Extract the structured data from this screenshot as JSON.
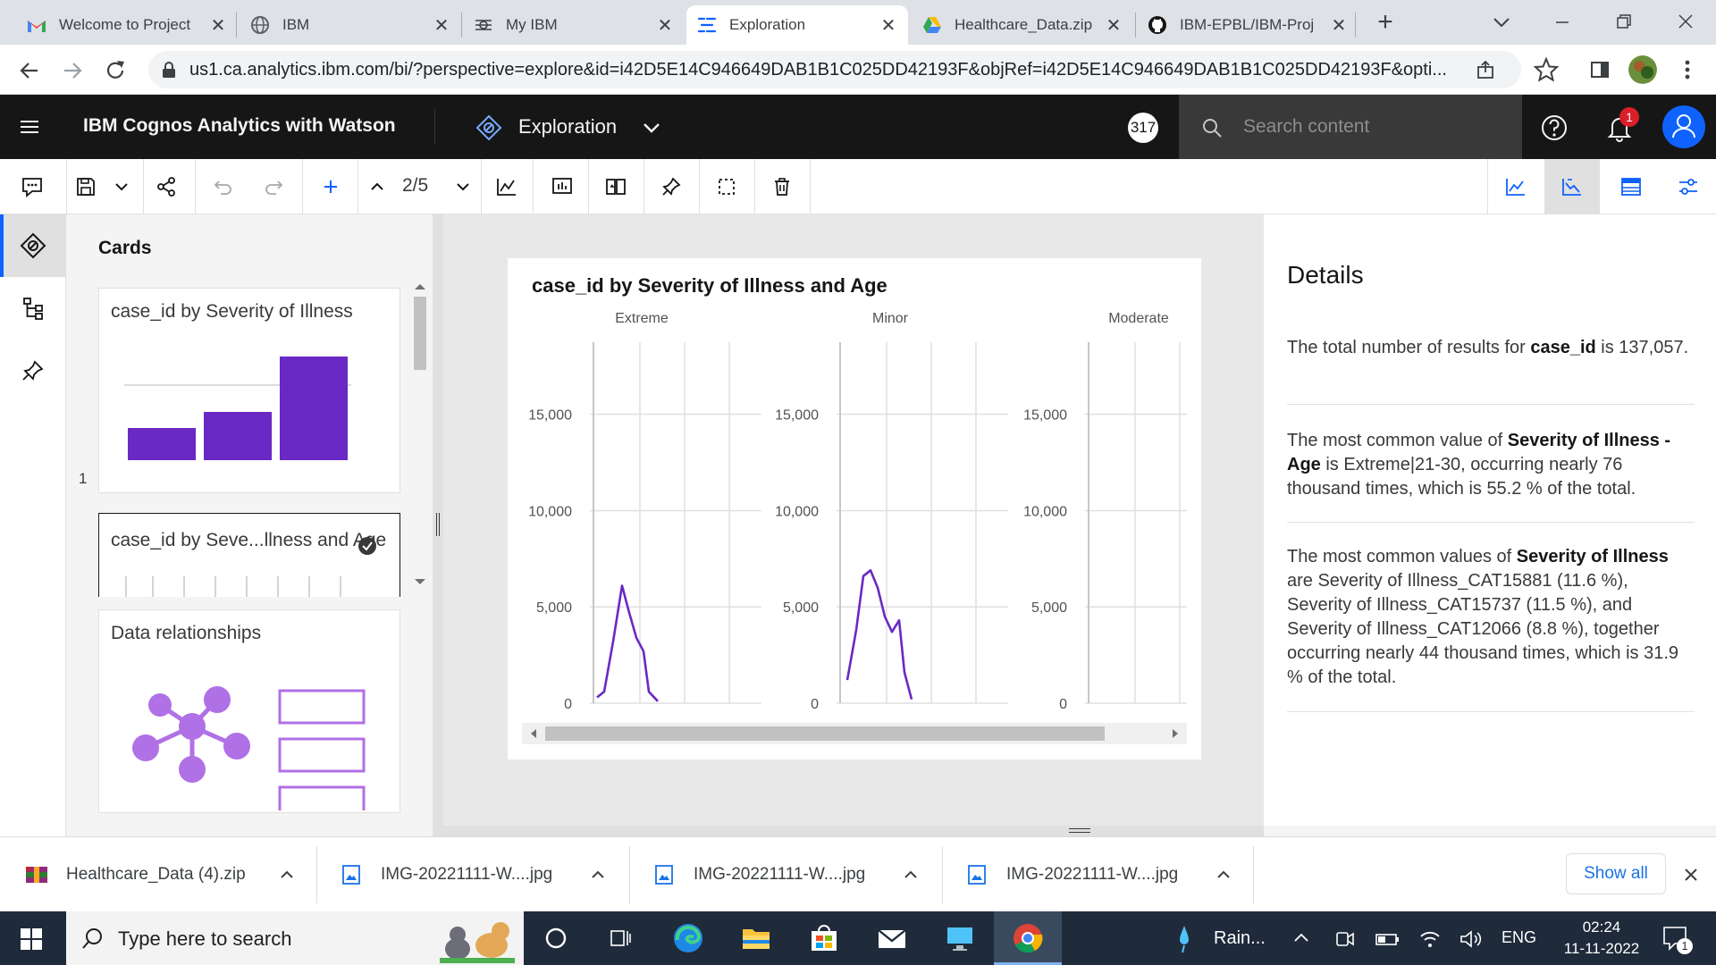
{
  "browser": {
    "tabs": [
      {
        "title": "Welcome to Project",
        "icon": "gmail-icon"
      },
      {
        "title": "IBM",
        "icon": "globe-icon"
      },
      {
        "title": "My IBM",
        "icon": "ibm-icon"
      },
      {
        "title": "Exploration",
        "icon": "cognos-icon",
        "active": true
      },
      {
        "title": "Healthcare_Data.zip",
        "icon": "drive-icon"
      },
      {
        "title": "IBM-EPBL/IBM-Proj",
        "icon": "github-icon"
      }
    ],
    "url": "us1.ca.analytics.ibm.com/bi/?perspective=explore&id=i42D5E14C946649DAB1B1C025DD42193F&objRef=i42D5E14C946649DAB1B1C025DD42193F&opti..."
  },
  "app": {
    "title": "IBM Cognos Analytics with Watson",
    "perspective": "Exploration",
    "badge": "317",
    "search_placeholder": "Search content",
    "notif_count": "1"
  },
  "toolbar": {
    "page": "2/5"
  },
  "cards": {
    "heading": "Cards",
    "card1_title": "case_id by Severity of Illness",
    "card1_index": "1",
    "card1_bars": [
      0.3,
      0.45,
      1.0
    ],
    "card2_title": "case_id by Seve...llness and Age",
    "card3_title": "Data relationships"
  },
  "viz": {
    "title": "case_id by Severity of Illness and Age",
    "chart_data": {
      "type": "line",
      "title": "case_id by Severity of Illness and Age",
      "panels": [
        "Extreme",
        "Minor",
        "Moderate"
      ],
      "y_ticks": [
        "15,000",
        "10,000",
        "5,000",
        "0"
      ],
      "ylim": [
        0,
        18000
      ],
      "series": [
        {
          "panel": "Extreme",
          "values": [
            300,
            600,
            3200,
            6100,
            4700,
            3400,
            2700,
            600,
            100
          ]
        },
        {
          "panel": "Minor",
          "values": [
            1200,
            3800,
            6600,
            6900,
            6000,
            4500,
            3700,
            4300,
            1600,
            200
          ]
        },
        {
          "panel": "Moderate",
          "values": []
        }
      ],
      "colors": {
        "line": "#6929c4"
      }
    }
  },
  "details": {
    "title": "Details",
    "p1_a": "The total number of results for ",
    "p1_b": "case_id",
    "p1_c": " is 137,057.",
    "p2_a": "The most common value of ",
    "p2_b": "Severity of Illness - Age",
    "p2_c": " is Extreme|21-30, occurring nearly 76 thousand times, which is 55.2 % of the total.",
    "p3_a": "The most common values of ",
    "p3_b": "Severity of Illness",
    "p3_c": " are Severity of Illness_CAT15881 (11.6 %), Severity of Illness_CAT15737 (11.5 %), and Severity of Illness_CAT12066 (8.8 %), together occurring nearly 44 thousand times, which is 31.9 % of the total."
  },
  "downloads": {
    "items": [
      "Healthcare_Data (4).zip",
      "IMG-20221111-W....jpg",
      "IMG-20221111-W....jpg",
      "IMG-20221111-W....jpg"
    ],
    "show_all": "Show all"
  },
  "taskbar": {
    "search_placeholder": "Type here to search",
    "weather": "Rain...",
    "lang": "ENG",
    "time": "02:24",
    "date": "11-11-2022",
    "notif_count": "1"
  }
}
